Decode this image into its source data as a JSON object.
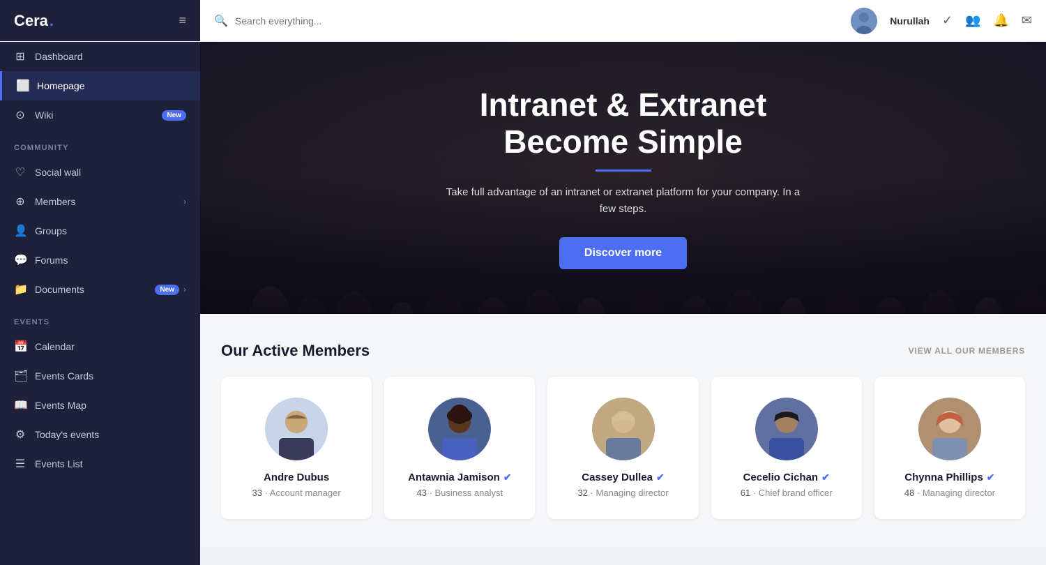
{
  "app": {
    "name": "Cera",
    "logo_dot": "."
  },
  "topbar": {
    "search_placeholder": "Search everything...",
    "user_name": "Nurullah",
    "icons": {
      "check": "✓",
      "people": "👥",
      "bell": "🔔",
      "mail": "✉"
    }
  },
  "sidebar": {
    "nav_items": [
      {
        "id": "dashboard",
        "label": "Dashboard",
        "icon": "⊞",
        "badge": null,
        "active": false,
        "has_chevron": false
      },
      {
        "id": "homepage",
        "label": "Homepage",
        "icon": "⬜",
        "badge": null,
        "active": true,
        "has_chevron": false
      },
      {
        "id": "wiki",
        "label": "Wiki",
        "icon": "⊙",
        "badge": "New",
        "active": false,
        "has_chevron": false
      }
    ],
    "community_section": {
      "label": "Community",
      "items": [
        {
          "id": "social-wall",
          "label": "Social wall",
          "icon": "♡",
          "badge": null,
          "active": false,
          "has_chevron": false
        },
        {
          "id": "members",
          "label": "Members",
          "icon": "⊕",
          "badge": null,
          "active": false,
          "has_chevron": true
        },
        {
          "id": "groups",
          "label": "Groups",
          "icon": "👤",
          "badge": null,
          "active": false,
          "has_chevron": false
        },
        {
          "id": "forums",
          "label": "Forums",
          "icon": "💬",
          "badge": null,
          "active": false,
          "has_chevron": false
        },
        {
          "id": "documents",
          "label": "Documents",
          "icon": "📁",
          "badge": "New",
          "active": false,
          "has_chevron": true
        }
      ]
    },
    "events_section": {
      "label": "Events",
      "items": [
        {
          "id": "calendar",
          "label": "Calendar",
          "icon": "📅",
          "badge": null,
          "active": false,
          "has_chevron": false
        },
        {
          "id": "events-cards",
          "label": "Events Cards",
          "icon": "🗂",
          "badge": null,
          "active": false,
          "has_chevron": false
        },
        {
          "id": "events-map",
          "label": "Events Map",
          "icon": "📖",
          "badge": null,
          "active": false,
          "has_chevron": false
        },
        {
          "id": "todays-events",
          "label": "Today's events",
          "icon": "⚙",
          "badge": null,
          "active": false,
          "has_chevron": false
        },
        {
          "id": "events-list",
          "label": "Events List",
          "icon": "☰",
          "badge": null,
          "active": false,
          "has_chevron": false
        }
      ]
    }
  },
  "hero": {
    "title_line1": "Intranet & Extranet",
    "title_line2": "Become Simple",
    "subtitle": "Take full advantage of an intranet or extranet platform for your company. In a few steps.",
    "button_label": "Discover more"
  },
  "members_section": {
    "title": "Our Active Members",
    "view_all_label": "VIEW ALL OUR MEMBERS",
    "members": [
      {
        "id": 1,
        "name": "Andre Dubus",
        "age": 33,
        "role": "Account manager",
        "verified": false,
        "avatar_class": "avatar-1"
      },
      {
        "id": 2,
        "name": "Antawnia Jamison",
        "age": 43,
        "role": "Business analyst",
        "verified": true,
        "avatar_class": "avatar-2"
      },
      {
        "id": 3,
        "name": "Cassey Dullea",
        "age": 32,
        "role": "Managing director",
        "verified": true,
        "avatar_class": "avatar-3"
      },
      {
        "id": 4,
        "name": "Cecelio Cichan",
        "age": 61,
        "role": "Chief brand officer",
        "verified": true,
        "avatar_class": "avatar-4"
      },
      {
        "id": 5,
        "name": "Chynna Phillips",
        "age": 48,
        "role": "Managing director",
        "verified": true,
        "avatar_class": "avatar-5"
      }
    ]
  }
}
